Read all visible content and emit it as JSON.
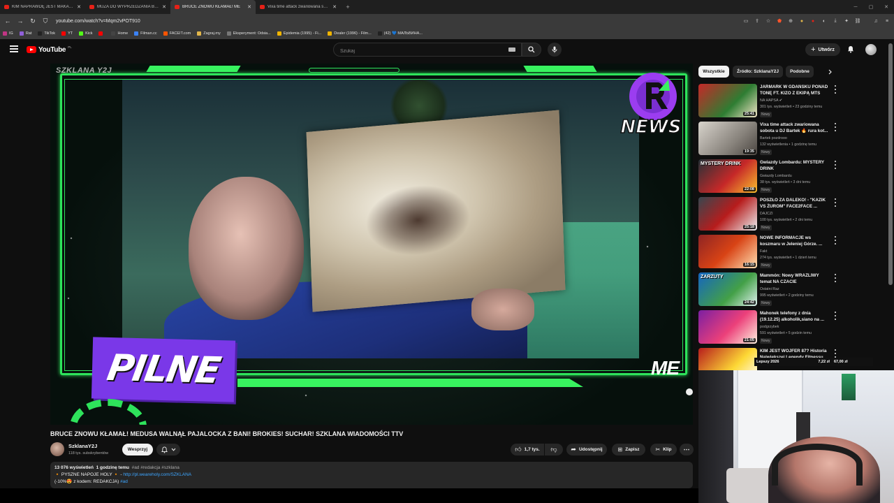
{
  "browser": {
    "tabs": [
      {
        "title": "KIM NAPRAWDĘ JEST MAKALIER? W",
        "active": false
      },
      {
        "title": "MUZA DO WYPRZEDZANIA BOEING",
        "active": false
      },
      {
        "title": "BRUCE ZNOWU KŁAMAŁ! ME",
        "active": true
      },
      {
        "title": "Vixa time attack zwariowana sobota",
        "active": false
      }
    ],
    "new_tab": "+",
    "url": "youtube.com/watch?v=Mqm2vPOT910",
    "bookmarks": [
      {
        "label": "IG",
        "color": "#c13584"
      },
      {
        "label": "Rat",
        "color": "#8f5fd8"
      },
      {
        "label": "TikTok",
        "color": "#222222"
      },
      {
        "label": "YT",
        "color": "#ff0000"
      },
      {
        "label": "Kick",
        "color": "#53fc18"
      },
      {
        "label": "",
        "color": "#ff0000"
      },
      {
        "label": "Home",
        "color": "#444444"
      },
      {
        "label": "Filman.cc",
        "color": "#3b82f6"
      },
      {
        "label": "FACEIT.com",
        "color": "#ff5500"
      },
      {
        "label": "Zagraj.my",
        "color": "#e2b64a"
      },
      {
        "label": "Eksperyment: Odsia...",
        "color": "#777777"
      },
      {
        "label": "Epidemia (1995) - Fi...",
        "color": "#f0b400"
      },
      {
        "label": "Dealer (1996) - Film...",
        "color": "#f0b400"
      },
      {
        "label": "(42) 💙 МАЛЬВИНА...",
        "color": "#222222"
      }
    ]
  },
  "masthead": {
    "logo_text": "YouTube",
    "country_code": "PL",
    "search_placeholder": "Szukaj",
    "create_label": "Utwórz"
  },
  "player": {
    "watermark": "SZKLANA Y2J",
    "news_logo_text": "NEWS",
    "banner_text": "PILNE",
    "ticker_text": "ME"
  },
  "video": {
    "title": "BRUCE ZNOWU KŁAMAŁ! MEDUSA WALNĄŁ PAJALOCKA Z BANI! BROKIES! SUCHAR! SZKLANA WIADOMOŚCI TTV",
    "channel_name": "SzklanaY2J",
    "subscribers": "118 tys. subskrybentów",
    "support_label": "Wesprzyj",
    "likes": "1,7 tys.",
    "share_label": "Udostępnij",
    "save_label": "Zapisz",
    "clip_label": "Klip",
    "description": {
      "views": "13 076 wyświetleń",
      "time": "1 godzinę temu",
      "tags": "#ad #redakcja #szklana",
      "line2_prefix": "🔸 PYSZNE NAPOJE HOLY 🔸 - ",
      "line2_link": "http://pl.weareholy.com/SZKLANA",
      "line3": "(-10%😍 z kodem: REDAKCJA) ",
      "line3_tag": "#ad"
    }
  },
  "sidebar": {
    "chips": [
      "Wszystkie",
      "Źródło: SzklanaY2J",
      "Podobne"
    ],
    "recommendations": [
      {
        "title": "JARMARK W GDAŃSKU PONAD TONĘ FT. KIZO Z EKIPĄ MTS",
        "channel": "NA HAPSA ✔",
        "meta": "301 tys. wyświetleń • 23 godziny temu",
        "badge": "Nowy",
        "duration": "25:41",
        "thumb_text": "",
        "thumb_bg": "linear-gradient(135deg,#c62828,#2e7d32 60%,#f5e6c8)"
      },
      {
        "title": "Vixa time attack zwariowana sobota u DJ Bartek 🔥 rura kot...",
        "channel": "Bartek pozdrooo",
        "meta": "132 wyświetlenia • 1 godzinę temu",
        "badge": "Nowy",
        "duration": "19:35",
        "thumb_text": "",
        "thumb_bg": "linear-gradient(135deg,#d8d4cc,#8a857e 60%,#4a4540)"
      },
      {
        "title": "Gwiazdy Lombardu: MYSTERY DRINK",
        "channel": "Gwiazdy Lombardu",
        "meta": "38 tys. wyświetleń • 3 dni temu",
        "badge": "Nowy",
        "duration": "22:08",
        "thumb_text": "MYSTERY DRINK",
        "thumb_bg": "linear-gradient(135deg,#263238,#c62828 55%,#fbc02d)"
      },
      {
        "title": "POSZŁO ZA DALEKO! - \"KAZIK VS ŻUROM\" FACE2FACE ...",
        "channel": "DAJCZI",
        "meta": "100 tys. wyświetleń • 2 dni temu",
        "badge": "Nowy",
        "duration": "25:18",
        "thumb_text": "",
        "thumb_bg": "linear-gradient(135deg,#37474f,#b71c1c 50%,#eceff1)"
      },
      {
        "title": "NOWE INFORMACJE ws koszmaru w Jeleniej Górze. ...",
        "channel": "Fakt",
        "meta": "274 tys. wyświetleń • 1 dzień temu",
        "badge": "Nowy",
        "duration": "16:15",
        "thumb_text": "",
        "thumb_bg": "linear-gradient(135deg,#8e2424,#d84315 50%,#ffe0b2)"
      },
      {
        "title": "Mammón: Nowy WRAŻLIWY temat NA CZACIE",
        "channel": "Ostatni Raz",
        "meta": "995 wyświetleń • 2 godziny temu",
        "badge": "Nowy",
        "duration": "24:42",
        "thumb_text": "ZARZUTY",
        "thumb_bg": "linear-gradient(135deg,#1565c0,#43a047 60%,#e0f2f1)"
      },
      {
        "title": "Mahonek telefony z dnia (19.12.25) alkoholik,siano na ...",
        "channel": "podgrzybek",
        "meta": "591 wyświetleń • 5 godzin temu",
        "badge": "Nowy",
        "duration": "21:05",
        "thumb_text": "",
        "thumb_bg": "linear-gradient(135deg,#7b1fa2,#ec407a 55%,#fff3e0)"
      },
      {
        "title": "KIM JEST WOJFER 87? Historia Największej Legendy Fitnessu",
        "channel": "",
        "meta": "",
        "badge": "",
        "duration": "",
        "thumb_text": "",
        "thumb_bg": "linear-gradient(135deg,#b71c1c,#fdd835 60%,#ffffff)"
      }
    ]
  },
  "overlay": {
    "label": "Lepszy 2026",
    "price1": "7,22 zł",
    "price2": "67,00 zł"
  }
}
